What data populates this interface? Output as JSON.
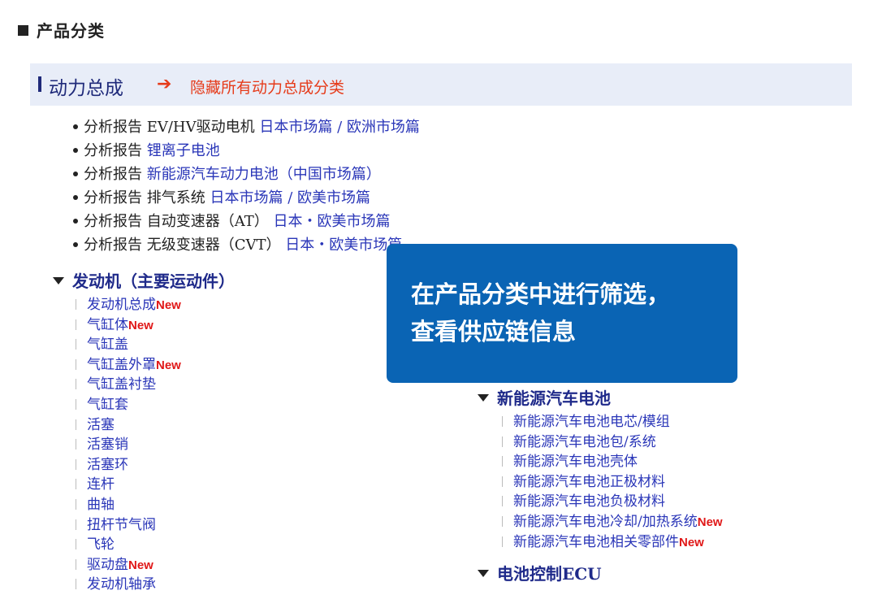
{
  "page_title": "产品分类",
  "section": {
    "title": "动力总成",
    "arrow": "➔",
    "hide_all_label": "隐藏所有动力总成分类"
  },
  "reports": [
    {
      "prefix": "分析报告 EV/HV驱动电机",
      "links": [
        "日本市场篇",
        "欧洲市场篇"
      ],
      "separator": "/"
    },
    {
      "prefix": "分析报告",
      "links": [
        "锂离子电池"
      ],
      "separator": ""
    },
    {
      "prefix": "分析报告",
      "links": [
        "新能源汽车动力电池（中国市场篇）"
      ],
      "separator": ""
    },
    {
      "prefix": "分析报告 排气系统",
      "links": [
        "日本市场篇",
        "欧美市场篇"
      ],
      "separator": "/"
    },
    {
      "prefix": "分析报告 自动变速器（AT）",
      "links": [
        "日本・欧美市场篇"
      ],
      "separator": ""
    },
    {
      "prefix": "分析报告 无级变速器（CVT）",
      "links": [
        "日本・欧美市场篇"
      ],
      "separator": ""
    }
  ],
  "categories": {
    "engine": {
      "title": "发动机（主要运动件）",
      "items": [
        {
          "label": "发动机总成",
          "new": "New"
        },
        {
          "label": "气缸体",
          "new": "New"
        },
        {
          "label": "气缸盖",
          "new": ""
        },
        {
          "label": "气缸盖外罩",
          "new": "New"
        },
        {
          "label": "气缸盖衬垫",
          "new": ""
        },
        {
          "label": "气缸套",
          "new": ""
        },
        {
          "label": "活塞",
          "new": ""
        },
        {
          "label": "活塞销",
          "new": ""
        },
        {
          "label": "活塞环",
          "new": ""
        },
        {
          "label": "连杆",
          "new": ""
        },
        {
          "label": "曲轴",
          "new": ""
        },
        {
          "label": "扭杆节气阀",
          "new": ""
        },
        {
          "label": "飞轮",
          "new": ""
        },
        {
          "label": "驱动盘",
          "new": "New"
        },
        {
          "label": "发动机轴承",
          "new": ""
        }
      ]
    },
    "battery": {
      "title": "新能源汽车电池",
      "items": [
        {
          "label": "新能源汽车电池电芯/模组",
          "new": ""
        },
        {
          "label": "新能源汽车电池包/系统",
          "new": ""
        },
        {
          "label": "新能源汽车电池壳体",
          "new": ""
        },
        {
          "label": "新能源汽车电池正极材料",
          "new": ""
        },
        {
          "label": "新能源汽车电池负极材料",
          "new": ""
        },
        {
          "label": "新能源汽车电池冷却/加热系统",
          "new": "New"
        },
        {
          "label": "新能源汽车电池相关零部件",
          "new": "New"
        }
      ]
    },
    "ecu": {
      "title": "电池控制ECU"
    }
  },
  "tooltip": {
    "line1": "在产品分类中进行筛选，",
    "line2": "查看供应链信息"
  },
  "colors": {
    "link": "#2a36b8",
    "accent": "#e63b1a",
    "tooltip_bg": "#0a64b4",
    "banner_bg": "#e8edf8"
  }
}
